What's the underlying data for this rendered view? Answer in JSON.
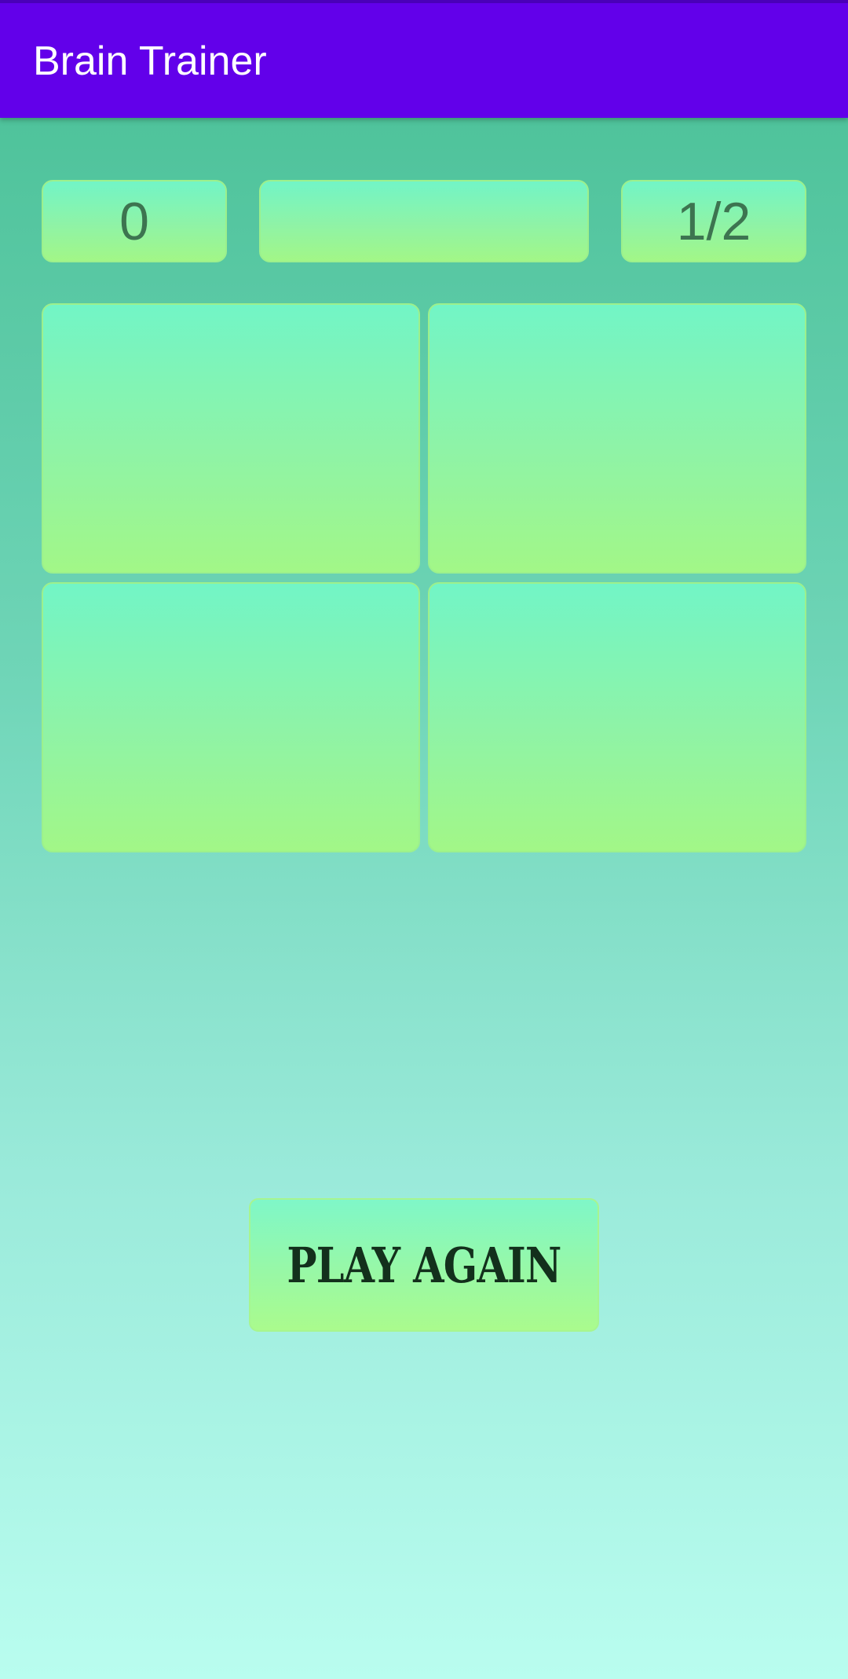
{
  "app_bar": {
    "title": "Brain Trainer",
    "color": "#6200ea"
  },
  "status": {
    "score": "0",
    "question": "",
    "progress": "1/2"
  },
  "answers": [
    "",
    "",
    "",
    ""
  ],
  "actions": {
    "play_again_label": "PLAY AGAIN"
  },
  "colors": {
    "tile_top": "#72f5c6",
    "tile_bottom": "#a2f787",
    "background_top": "#48bf95",
    "background_bottom": "#b9fdef"
  }
}
